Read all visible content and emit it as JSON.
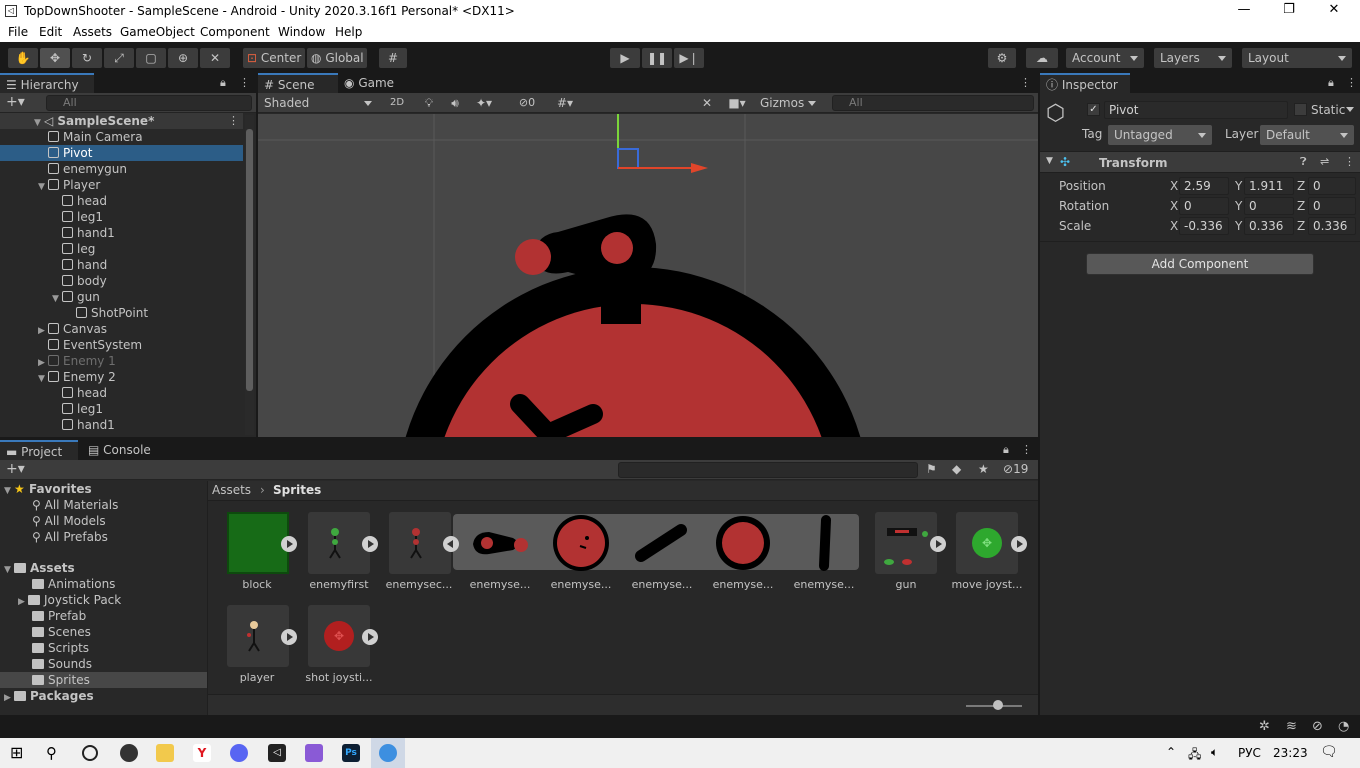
{
  "window": {
    "title": "TopDownShooter - SampleScene - Android - Unity 2020.3.16f1 Personal* <DX11>"
  },
  "menu": [
    "File",
    "Edit",
    "Assets",
    "GameObject",
    "Component",
    "Window",
    "Help"
  ],
  "toolbar": {
    "pivot_mode": "Center",
    "space_mode": "Global",
    "account": "Account",
    "layers": "Layers",
    "layout": "Layout"
  },
  "hierarchy": {
    "tab": "Hierarchy",
    "search_placeholder": "All",
    "scene": "SampleScene*",
    "rows": [
      {
        "label": "Main Camera",
        "indent": 1,
        "arrow": ""
      },
      {
        "label": "Pivot",
        "indent": 1,
        "arrow": "",
        "selected": true
      },
      {
        "label": "enemygun",
        "indent": 1,
        "arrow": ""
      },
      {
        "label": "Player",
        "indent": 1,
        "arrow": "▼"
      },
      {
        "label": "head",
        "indent": 2,
        "arrow": ""
      },
      {
        "label": "leg1",
        "indent": 2,
        "arrow": ""
      },
      {
        "label": "hand1",
        "indent": 2,
        "arrow": ""
      },
      {
        "label": "leg",
        "indent": 2,
        "arrow": ""
      },
      {
        "label": "hand",
        "indent": 2,
        "arrow": ""
      },
      {
        "label": "body",
        "indent": 2,
        "arrow": ""
      },
      {
        "label": "gun",
        "indent": 2,
        "arrow": "▼"
      },
      {
        "label": "ShotPoint",
        "indent": 3,
        "arrow": ""
      },
      {
        "label": "Canvas",
        "indent": 1,
        "arrow": "▶"
      },
      {
        "label": "EventSystem",
        "indent": 1,
        "arrow": ""
      },
      {
        "label": "Enemy 1",
        "indent": 1,
        "arrow": "▶",
        "dim": true
      },
      {
        "label": "Enemy 2",
        "indent": 1,
        "arrow": "▼"
      },
      {
        "label": "head",
        "indent": 2,
        "arrow": ""
      },
      {
        "label": "leg1",
        "indent": 2,
        "arrow": ""
      },
      {
        "label": "hand1",
        "indent": 2,
        "arrow": ""
      }
    ]
  },
  "scene": {
    "tab_scene": "Scene",
    "tab_game": "Game",
    "shading": "Shaded",
    "mode_2d": "2D",
    "hidden_count": "0",
    "gizmos": "Gizmos",
    "search_placeholder": "All"
  },
  "inspector": {
    "tab": "Inspector",
    "object_name": "Pivot",
    "static_label": "Static",
    "tag_label": "Tag",
    "tag_value": "Untagged",
    "layer_label": "Layer",
    "layer_value": "Default",
    "component": "Transform",
    "position_label": "Position",
    "rotation_label": "Rotation",
    "scale_label": "Scale",
    "axis_x": "X",
    "axis_y": "Y",
    "axis_z": "Z",
    "position": {
      "x": "2.59",
      "y": "1.911",
      "z": "0"
    },
    "rotation": {
      "x": "0",
      "y": "0",
      "z": "0"
    },
    "scale": {
      "x": "-0.336",
      "y": "0.336",
      "z": "0.336"
    },
    "add_component": "Add Component"
  },
  "project": {
    "tab_project": "Project",
    "tab_console": "Console",
    "hidden_count": "19",
    "favorites": "Favorites",
    "fav_items": [
      "All Materials",
      "All Models",
      "All Prefabs"
    ],
    "assets_root": "Assets",
    "folders": [
      "Animations",
      "Joystick Pack",
      "Prefab",
      "Scenes",
      "Scripts",
      "Sounds",
      "Sprites"
    ],
    "packages": "Packages",
    "breadcrumb_root": "Assets",
    "breadcrumb_leaf": "Sprites",
    "assets": [
      "block",
      "enemyfirst",
      "enemysec...",
      "enemyse...",
      "enemyse...",
      "enemyse...",
      "enemyse...",
      "enemyse...",
      "gun",
      "move joyst...",
      "player",
      "shot joysti..."
    ]
  },
  "taskbar": {
    "lang": "РУС",
    "time": "23:23"
  },
  "colors": {
    "accent": "#3a79bb",
    "selection": "#2c5d87",
    "enemy_red": "#b23232",
    "panel": "#282828"
  }
}
